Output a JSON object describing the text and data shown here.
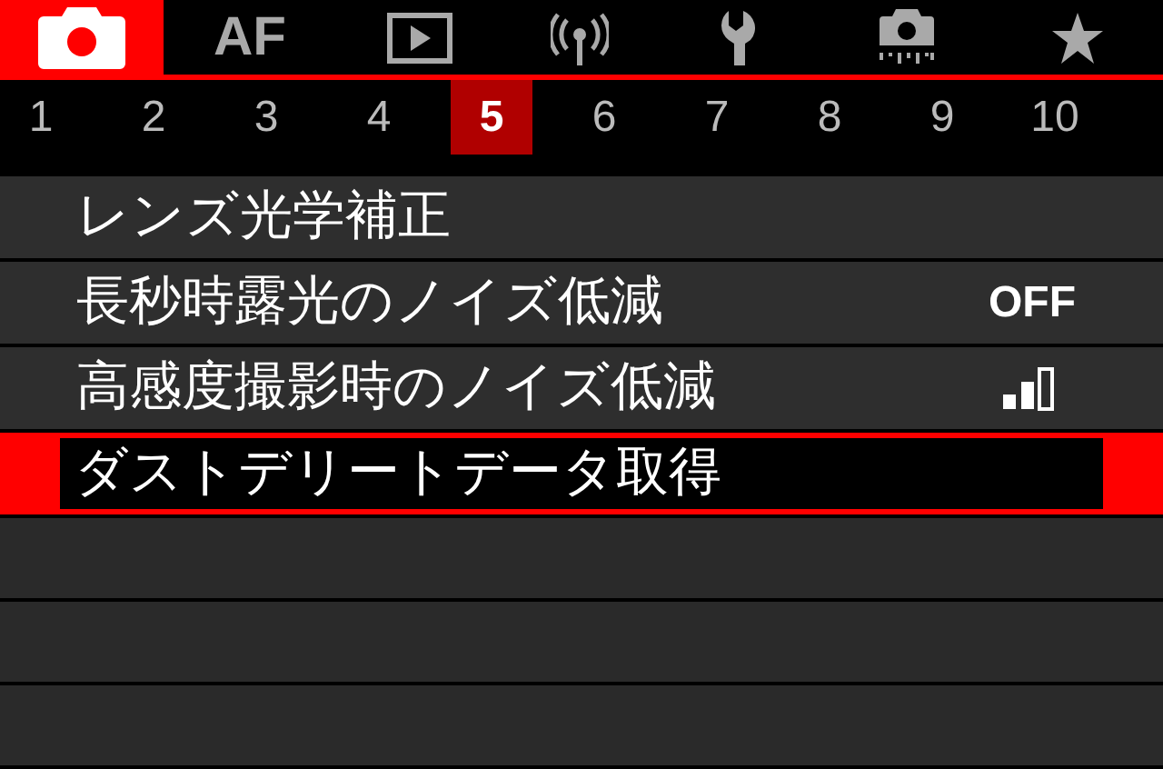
{
  "tabs": [
    {
      "kind": "camera",
      "selected": true
    },
    {
      "kind": "text",
      "label": "AF",
      "selected": false
    },
    {
      "kind": "play",
      "selected": false
    },
    {
      "kind": "wireless",
      "selected": false
    },
    {
      "kind": "wrench",
      "selected": false
    },
    {
      "kind": "sensor",
      "selected": false
    },
    {
      "kind": "star",
      "selected": false
    }
  ],
  "pages": [
    {
      "label": "1",
      "selected": false
    },
    {
      "label": "2",
      "selected": false
    },
    {
      "label": "3",
      "selected": false
    },
    {
      "label": "4",
      "selected": false
    },
    {
      "label": "5",
      "selected": true
    },
    {
      "label": "6",
      "selected": false
    },
    {
      "label": "7",
      "selected": false
    },
    {
      "label": "8",
      "selected": false
    },
    {
      "label": "9",
      "selected": false
    },
    {
      "label": "10",
      "selected": false
    }
  ],
  "menu_items": [
    {
      "kind": "plain",
      "label": "レンズ光学補正",
      "selected": false
    },
    {
      "kind": "text_value",
      "label": "長秒時露光のノイズ低減",
      "value": "OFF",
      "selected": false
    },
    {
      "kind": "bars",
      "label": "高感度撮影時のノイズ低減",
      "level": 0.67,
      "selected": false
    },
    {
      "kind": "plain",
      "label": "ダストデリートデータ取得",
      "selected": true
    }
  ]
}
